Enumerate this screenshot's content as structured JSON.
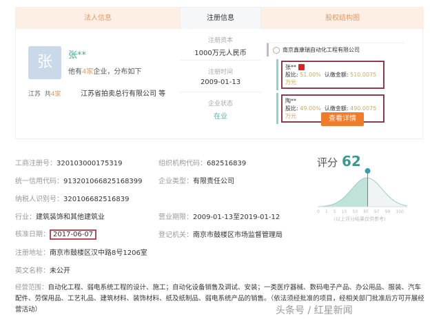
{
  "tabs": {
    "legal": "法人信息",
    "reg": "注册信息",
    "equity": "股权结构图"
  },
  "legal": {
    "avatar": "张",
    "name": "张**",
    "summary_pre": "他有",
    "summary_count": "4家",
    "summary_post": "企业，分布如下",
    "province": "江苏",
    "prov_pre": "共",
    "prov_count": "4家",
    "company": "江苏省拍卖总行有限公司 等"
  },
  "reg": {
    "capital_label": "注册资本",
    "capital": "1000万元人民币",
    "time_label": "注册时间",
    "time": "2009-01-13",
    "status_label": "企业状态",
    "status": "在业"
  },
  "equity": {
    "company": "南京鑫康瑞自动化工程有限公司",
    "holders": [
      {
        "name": "张**",
        "ratio_label": "股比:",
        "ratio": "51.00%",
        "amount_label": "认缴金额:",
        "amount": "510.0075万元"
      },
      {
        "name": "陶**",
        "ratio_label": "股比:",
        "ratio": "49.00%",
        "amount_label": "认缴金额:",
        "amount": "490.0075万元"
      }
    ],
    "button": "查看详情"
  },
  "fields": [
    {
      "k": "工商注册号：",
      "v": "320103000175319"
    },
    {
      "k": "组织机构代码：",
      "v": "682516839"
    },
    {
      "k": "统一信用代码：",
      "v": "913201066825168399"
    },
    {
      "k": "企业类型：",
      "v": "有限责任公司"
    },
    {
      "k": "纳税人识别号：",
      "v": "320106682516839"
    },
    {
      "k": "行业：",
      "v": "建筑装饰和其他建筑业"
    },
    {
      "k": "营业期限：",
      "v": "2009-01-13至2019-01-12"
    },
    {
      "k": "核准日期：",
      "v": "2017-06-07"
    },
    {
      "k": "登记机关：",
      "v": "南京市鼓楼区市场监督管理局"
    },
    {
      "k": "注册地址：",
      "v": "南京市鼓楼区汉中路8号1206室"
    },
    {
      "k": "英文名称：",
      "v": "未公开"
    },
    {
      "k": "经营范围：",
      "v": "自动化工程、弱电系统工程的设计、施工；自动化设备销售及调试、安装；一类医疗器械、数码电子产品、办公用品、服装、汽车配件、劳保用品、工艺礼品、建筑材料、装饰材料、纸及纸制品、弱电系统产品的销售。（依法须经批准的项目，经相关部门批准后方可开展经营活动）"
    }
  ],
  "score": {
    "label": "评分",
    "value": 62,
    "ticks": [
      "0",
      "1",
      "5",
      "15",
      "50",
      "85",
      "97",
      "99",
      "100"
    ],
    "note": "（以上评分结果仅供参考）"
  },
  "watermark": "头条号 / 红星新闻"
}
